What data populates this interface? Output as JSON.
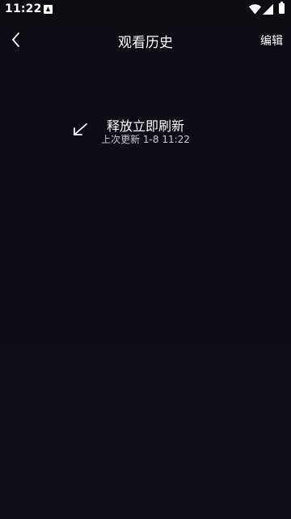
{
  "status_bar": {
    "time": "11:22",
    "notification_icon": "a-box-icon",
    "wifi_icon": "wifi-icon",
    "signal_icon": "cell-signal-icon",
    "battery_icon": "battery-icon"
  },
  "nav": {
    "back_icon": "chevron-left-icon",
    "title": "观看历史",
    "edit_label": "编辑"
  },
  "refresh": {
    "arrow_icon": "arrow-down-left-icon",
    "status_text": "释放立即刷新",
    "last_updated": "上次更新 1-8 11:22"
  },
  "colors": {
    "background": "#0d0d16",
    "text_primary": "#ffffff",
    "text_secondary": "#c8c8d0"
  }
}
